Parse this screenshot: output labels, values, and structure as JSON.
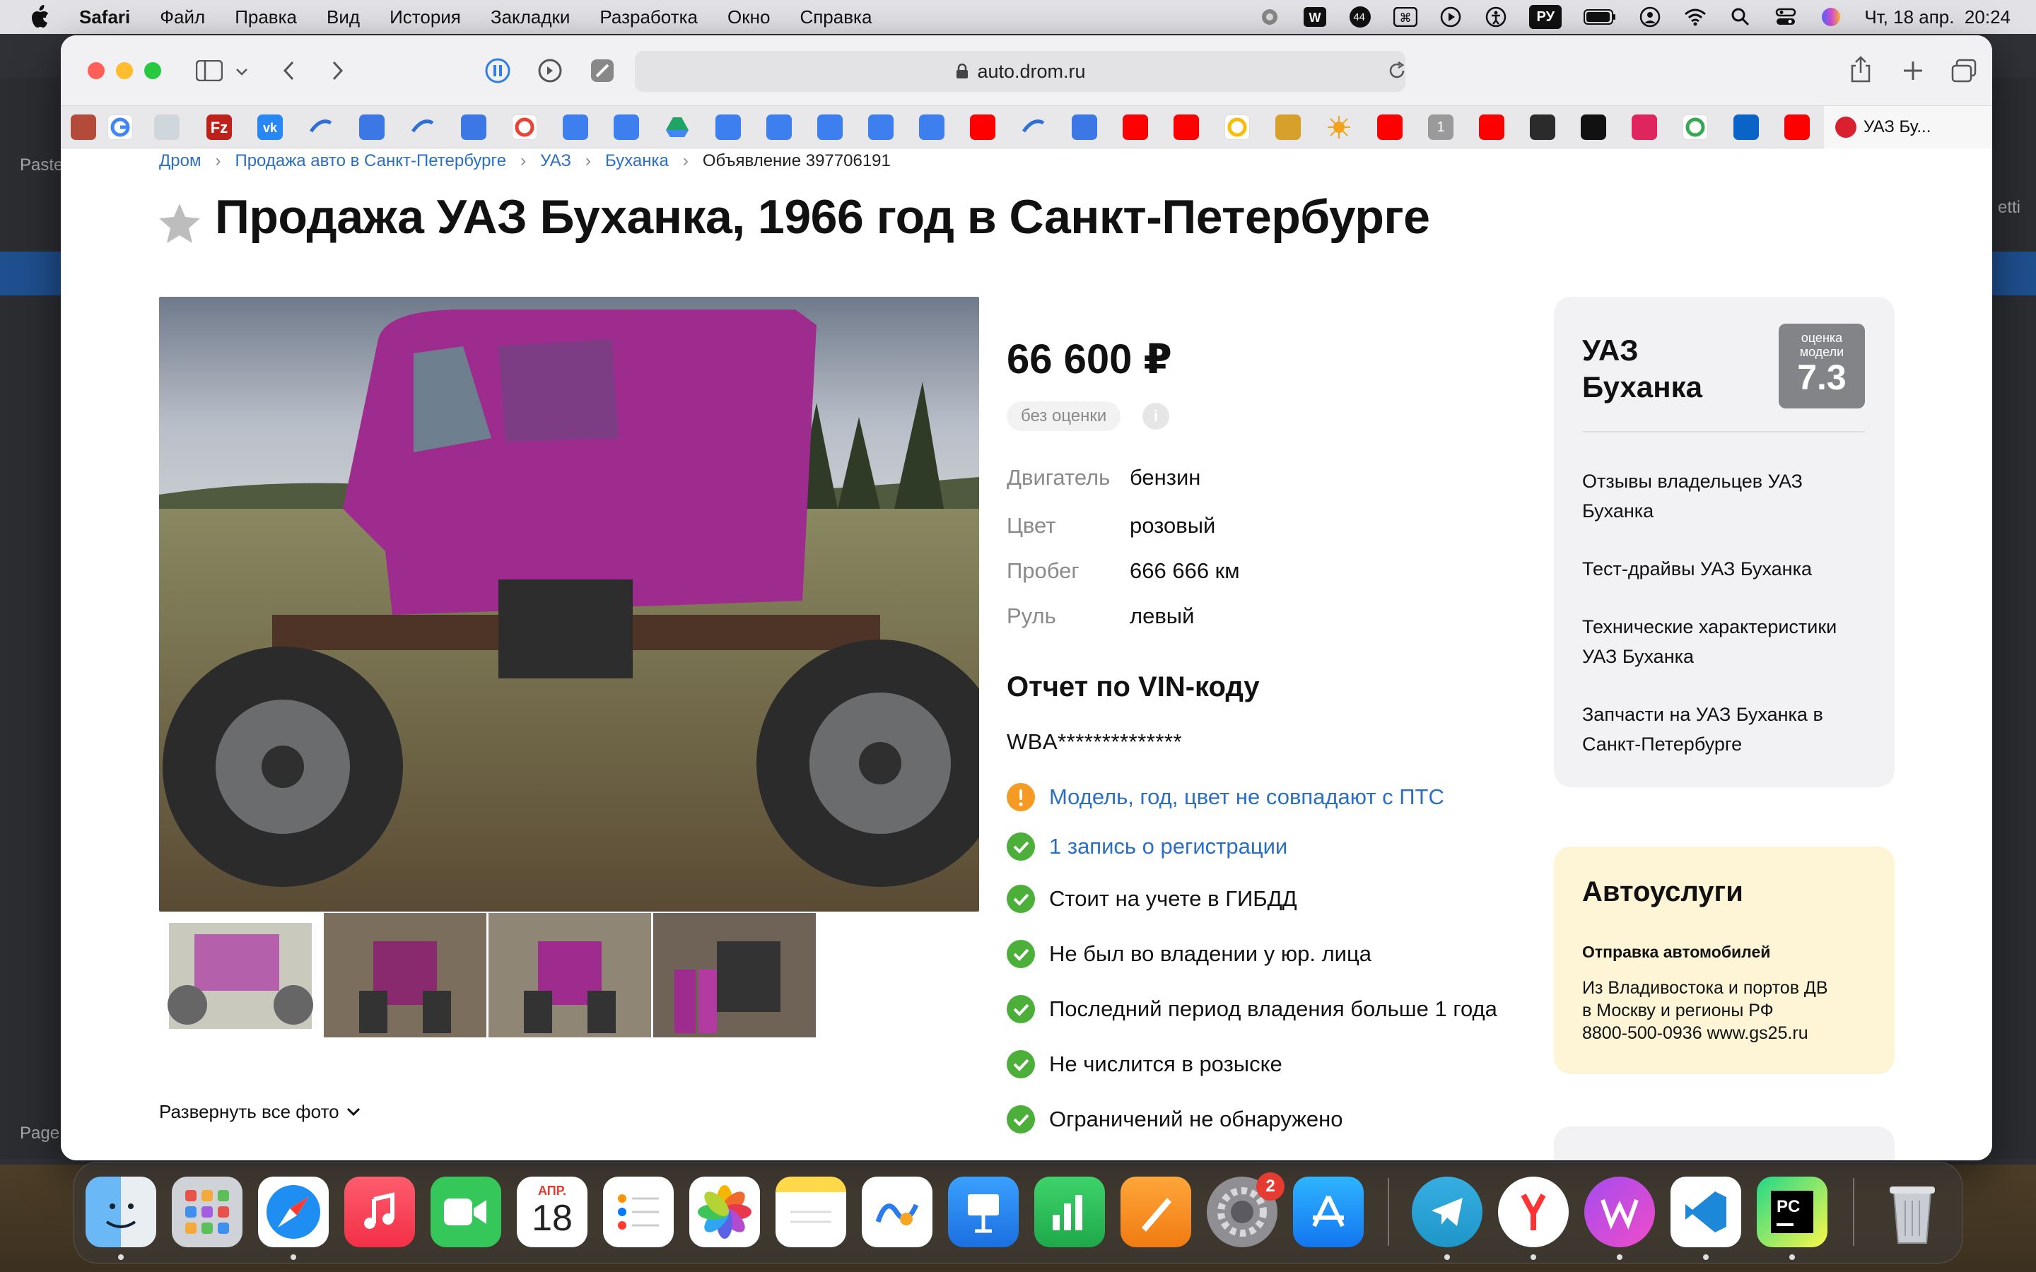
{
  "menubar": {
    "app": "Safari",
    "items": [
      "Файл",
      "Правка",
      "Вид",
      "История",
      "Закладки",
      "Разработка",
      "Окно",
      "Справка"
    ],
    "lang": "РУ",
    "badge_count": "44",
    "datetime": "Чт, 18 апр.  20:24"
  },
  "browser": {
    "url": "auto.drom.ru",
    "active_tab": "УАЗ Бу...",
    "bookmark_badge": "1"
  },
  "background_app": {
    "paste_label": "Paste",
    "page_label": "Page",
    "settings_label": "etti"
  },
  "breadcrumbs": [
    "Дром",
    "Продажа авто в Санкт-Петербурге",
    "УАЗ",
    "Буханка"
  ],
  "breadcrumb_current": "Объявление 397706191",
  "title": "Продажа УАЗ Буханка, 1966 год в Санкт-Петербурге",
  "listing": {
    "price": "66 600 ₽",
    "rating_label": "без оценки",
    "info_glyph": "i",
    "specs": [
      {
        "label": "Двигатель",
        "value": "бензин"
      },
      {
        "label": "Цвет",
        "value": "розовый"
      },
      {
        "label": "Пробег",
        "value": "666 666 км"
      },
      {
        "label": "Руль",
        "value": "левый"
      }
    ],
    "expand_photos": "Развернуть все фото"
  },
  "vin_report": {
    "title": "Отчет по VIN-коду",
    "vin": "WBA**************",
    "checks": [
      {
        "text": "Модель, год, цвет не совпадают с ПТС",
        "status": "warning",
        "link": true
      },
      {
        "text": "1 запись о регистрации",
        "status": "ok",
        "link": true
      },
      {
        "text": "Стоит на учете в ГИБДД",
        "status": "ok",
        "link": false
      },
      {
        "text": "Не был во владении у юр. лица",
        "status": "ok",
        "link": false
      },
      {
        "text": "Последний период владения больше 1 года",
        "status": "ok",
        "link": false
      },
      {
        "text": "Не числится в розыске",
        "status": "ok",
        "link": false
      },
      {
        "text": "Ограничений не обнаружено",
        "status": "ok",
        "link": false
      }
    ]
  },
  "model_card": {
    "name": "УАЗ Буханка",
    "score_label": "оценка модели",
    "score": "7.3",
    "links": [
      "Отзывы владельцев УАЗ Буханка",
      "Тест-драйвы УАЗ Буханка",
      "Технические характеристики УАЗ Буханка",
      "Запчасти на УАЗ Буханка в Санкт-Петербурге"
    ]
  },
  "services_card": {
    "title": "Автоуслуги",
    "subtitle": "Отправка автомобилей",
    "lines": [
      "Из Владивостока и портов ДВ",
      "в Москву и регионы РФ",
      "8800-500-0936 www.gs25.ru"
    ]
  },
  "dock": {
    "calendar_month": "АПР.",
    "calendar_day": "18",
    "settings_badge": "2"
  },
  "colors": {
    "link": "#2a6ec6",
    "ok_green": "#4caf3a",
    "warning_orange": "#f59a23",
    "score_grey": "#828488",
    "services_bg": "#fdf5d6"
  }
}
